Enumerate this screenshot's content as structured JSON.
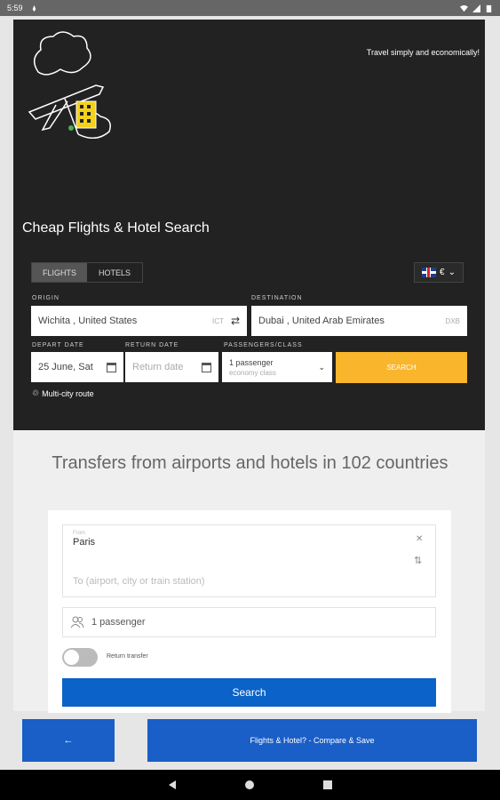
{
  "status_bar": {
    "time": "5:59"
  },
  "hero": {
    "tagline": "Travel simply and economically!",
    "title": "Cheap Flights & Hotel Search",
    "tabs": [
      "FLIGHTS",
      "HOTELS"
    ],
    "currency": "€"
  },
  "flight_form": {
    "origin_label": "ORIGIN",
    "origin_value": "Wichita , United States",
    "origin_code": "ICT",
    "destination_label": "DESTINATION",
    "destination_value": "Dubai , United Arab Emirates",
    "destination_code": "DXB",
    "depart_label": "DEPART DATE",
    "depart_value": "25 June, Sat",
    "return_label": "RETURN DATE",
    "return_placeholder": "Return date",
    "pax_label": "PASSENGERS/CLASS",
    "pax_value": "1 passenger",
    "pax_class": "economy class",
    "search_label": "SEARCH",
    "multicity_label": "Multi-city route"
  },
  "transfer": {
    "title": "Transfers from airports and hotels in 102 countries",
    "from_label": "From",
    "from_value": "Paris",
    "to_placeholder": "To (airport, city or train station)",
    "passengers": "1 passenger",
    "return_transfer": "Return transfer",
    "search_label": "Search"
  },
  "bottom": {
    "back_label": "←",
    "compare_label": "Flights & Hotel? - Compare & Save"
  }
}
